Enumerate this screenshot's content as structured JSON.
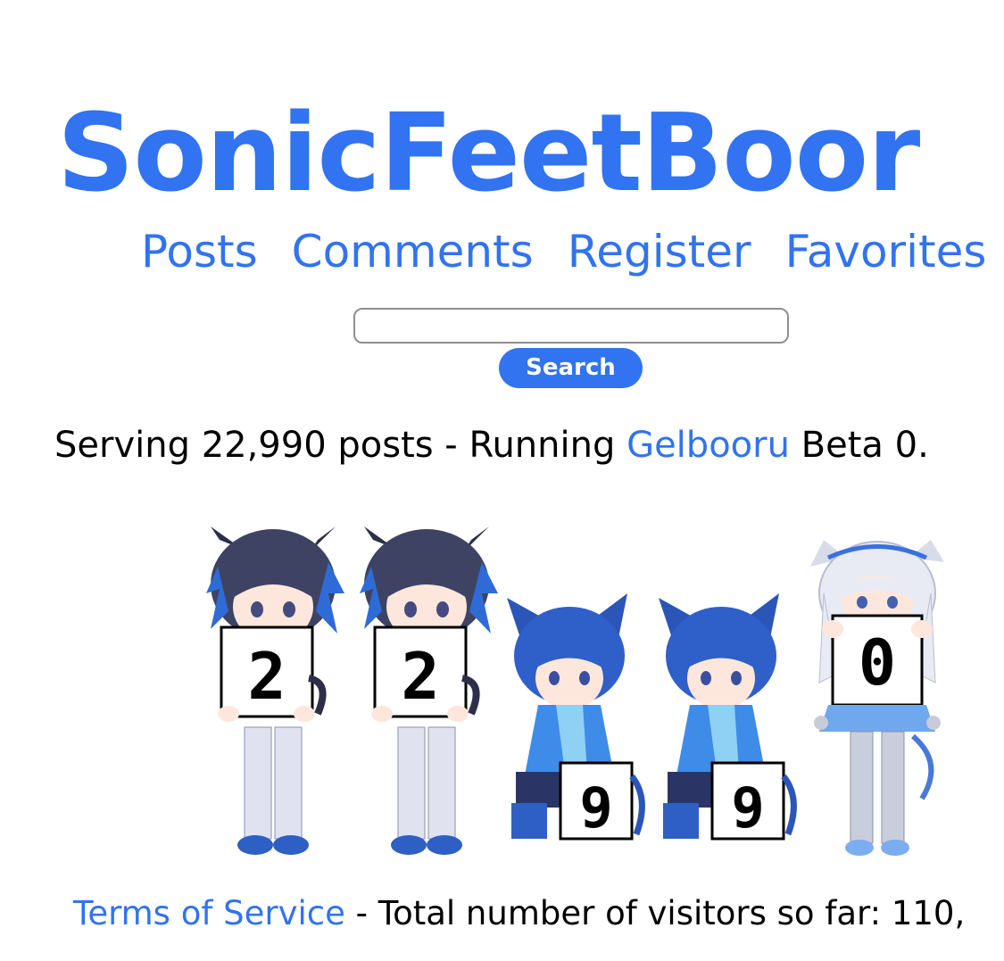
{
  "site": {
    "title": "SonicFeetBoor"
  },
  "nav": {
    "items": [
      "Posts",
      "Comments",
      "Register",
      "Favorites"
    ]
  },
  "search": {
    "value": "",
    "placeholder": "",
    "button_label": "Search"
  },
  "stats": {
    "prefix": "Serving 22,990 posts - Running ",
    "software_link": "Gelbooru",
    "suffix": " Beta 0."
  },
  "counter": {
    "digits": [
      "2",
      "2",
      "9",
      "9",
      "0"
    ]
  },
  "footer": {
    "tos_link": "Terms of Service",
    "visitors_text": " - Total number of visitors so far: 110,"
  },
  "colors": {
    "link": "#3173f0",
    "text": "#000000",
    "background": "#ffffff"
  }
}
